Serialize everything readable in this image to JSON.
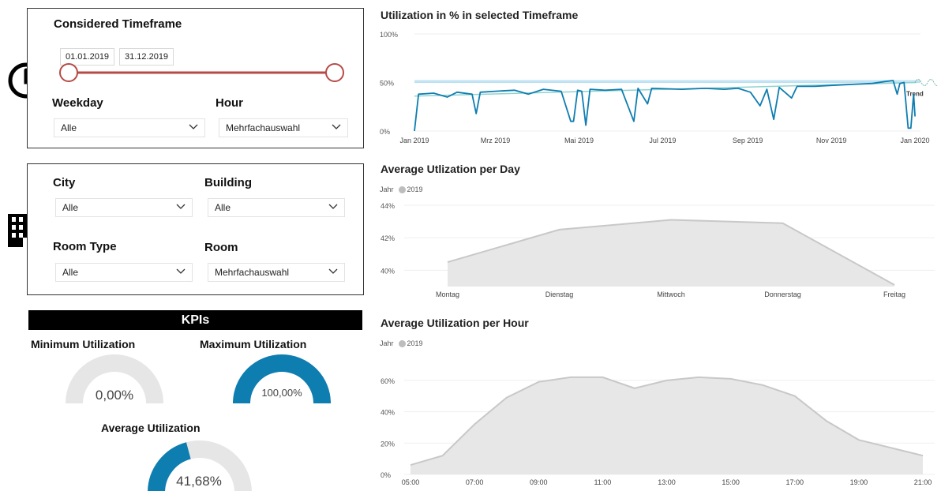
{
  "filters_time": {
    "title": "Considered Timeframe",
    "start_date": "01.01.2019",
    "end_date": "31.12.2019",
    "weekday_label": "Weekday",
    "weekday_value": "Alle",
    "hour_label": "Hour",
    "hour_value": "Mehrfachauswahl"
  },
  "filters_location": {
    "city_label": "City",
    "city_value": "Alle",
    "building_label": "Building",
    "building_value": "Alle",
    "roomtype_label": "Room Type",
    "roomtype_value": "Alle",
    "room_label": "Room",
    "room_value": "Mehrfachauswahl"
  },
  "kpis": {
    "header": "KPIs",
    "min_label": "Minimum Utilization",
    "min_value": "0,00%",
    "min_fraction": 0.0,
    "max_label": "Maximum Utilization",
    "max_value": "100,00%",
    "max_fraction": 1.0,
    "avg_label": "Average Utilization",
    "avg_value": "41,68%",
    "avg_fraction": 0.4168
  },
  "colors": {
    "accent": "#0e7db0",
    "gauge_bg": "#e6e6e6",
    "slider": "#b54a46",
    "area_fill": "#e7e7e7",
    "area_line": "#c8c8c8",
    "trend": "#8fd3cf",
    "band": "#a9d8ef"
  },
  "icons": [
    "clock-icon",
    "building-icon"
  ],
  "chart_data": [
    {
      "type": "line",
      "title": "Utilization in % in selected Timeframe",
      "y_ticks": [
        "100%",
        "50%",
        "0%"
      ],
      "ylim": [
        0,
        100
      ],
      "x_tick_labels": [
        "Jan 2019",
        "Mrz 2019",
        "Mai 2019",
        "Jul 2019",
        "Sep 2019",
        "Nov 2019",
        "Jan 2020"
      ],
      "annotation": "Trend",
      "series": [
        {
          "values": [
            {
              "x": "2019-01-01",
              "y": 0
            },
            {
              "x": "2019-01-04",
              "y": 38
            },
            {
              "x": "2019-01-15",
              "y": 39
            },
            {
              "x": "2019-01-25",
              "y": 35
            },
            {
              "x": "2019-02-01",
              "y": 40
            },
            {
              "x": "2019-02-12",
              "y": 38
            },
            {
              "x": "2019-02-15",
              "y": 18
            },
            {
              "x": "2019-02-18",
              "y": 40
            },
            {
              "x": "2019-03-01",
              "y": 41
            },
            {
              "x": "2019-03-15",
              "y": 42
            },
            {
              "x": "2019-03-25",
              "y": 38
            },
            {
              "x": "2019-04-05",
              "y": 43
            },
            {
              "x": "2019-04-18",
              "y": 41
            },
            {
              "x": "2019-04-25",
              "y": 10
            },
            {
              "x": "2019-04-27",
              "y": 10
            },
            {
              "x": "2019-04-30",
              "y": 42
            },
            {
              "x": "2019-05-03",
              "y": 41
            },
            {
              "x": "2019-05-06",
              "y": 6
            },
            {
              "x": "2019-05-09",
              "y": 43
            },
            {
              "x": "2019-05-20",
              "y": 42
            },
            {
              "x": "2019-06-01",
              "y": 43
            },
            {
              "x": "2019-06-10",
              "y": 10
            },
            {
              "x": "2019-06-13",
              "y": 44
            },
            {
              "x": "2019-06-20",
              "y": 28
            },
            {
              "x": "2019-06-23",
              "y": 44
            },
            {
              "x": "2019-07-15",
              "y": 43
            },
            {
              "x": "2019-08-01",
              "y": 44
            },
            {
              "x": "2019-08-15",
              "y": 43
            },
            {
              "x": "2019-08-25",
              "y": 44
            },
            {
              "x": "2019-09-03",
              "y": 40
            },
            {
              "x": "2019-09-10",
              "y": 26
            },
            {
              "x": "2019-09-15",
              "y": 43
            },
            {
              "x": "2019-09-20",
              "y": 12
            },
            {
              "x": "2019-09-24",
              "y": 45
            },
            {
              "x": "2019-10-03",
              "y": 34
            },
            {
              "x": "2019-10-07",
              "y": 46
            },
            {
              "x": "2019-10-20",
              "y": 46
            },
            {
              "x": "2019-11-01",
              "y": 47
            },
            {
              "x": "2019-11-15",
              "y": 48
            },
            {
              "x": "2019-12-01",
              "y": 49
            },
            {
              "x": "2019-12-10",
              "y": 51
            },
            {
              "x": "2019-12-16",
              "y": 52
            },
            {
              "x": "2019-12-19",
              "y": 38
            },
            {
              "x": "2019-12-21",
              "y": 49
            },
            {
              "x": "2019-12-24",
              "y": 50
            },
            {
              "x": "2019-12-27",
              "y": 3
            },
            {
              "x": "2019-12-29",
              "y": 3
            },
            {
              "x": "2019-12-31",
              "y": 38
            },
            {
              "x": "2020-01-01",
              "y": 15
            }
          ]
        }
      ],
      "trend": [
        {
          "x": "2019-01-01",
          "y": 36
        },
        {
          "x": "2020-01-02",
          "y": 50
        }
      ]
    },
    {
      "type": "area",
      "title": "Average Utlization per Day",
      "legend_label": "Jahr",
      "legend_series": "2019",
      "categories": [
        "Montag",
        "Dienstag",
        "Mittwoch",
        "Donnerstag",
        "Freitag"
      ],
      "y_ticks": [
        "44%",
        "42%",
        "40%"
      ],
      "ylim": [
        39,
        44
      ],
      "series": [
        {
          "name": "2019",
          "values": [
            40.5,
            42.5,
            43.1,
            42.9,
            39.1
          ]
        }
      ]
    },
    {
      "type": "area",
      "title": "Average Utilization per Hour",
      "legend_label": "Jahr",
      "legend_series": "2019",
      "x_tick_labels": [
        "05:00",
        "07:00",
        "09:00",
        "11:00",
        "13:00",
        "15:00",
        "17:00",
        "19:00",
        "21:00"
      ],
      "y_ticks": [
        "60%",
        "40%",
        "20%",
        "0%"
      ],
      "ylim": [
        0,
        70
      ],
      "x": [
        "05:00",
        "06:00",
        "07:00",
        "08:00",
        "09:00",
        "10:00",
        "11:00",
        "12:00",
        "13:00",
        "14:00",
        "15:00",
        "16:00",
        "17:00",
        "18:00",
        "19:00",
        "20:00",
        "21:00"
      ],
      "series": [
        {
          "name": "2019",
          "values": [
            6,
            12,
            32,
            49,
            59,
            62,
            62,
            55,
            60,
            62,
            61,
            57,
            50,
            34,
            22,
            17,
            12
          ]
        }
      ]
    }
  ]
}
